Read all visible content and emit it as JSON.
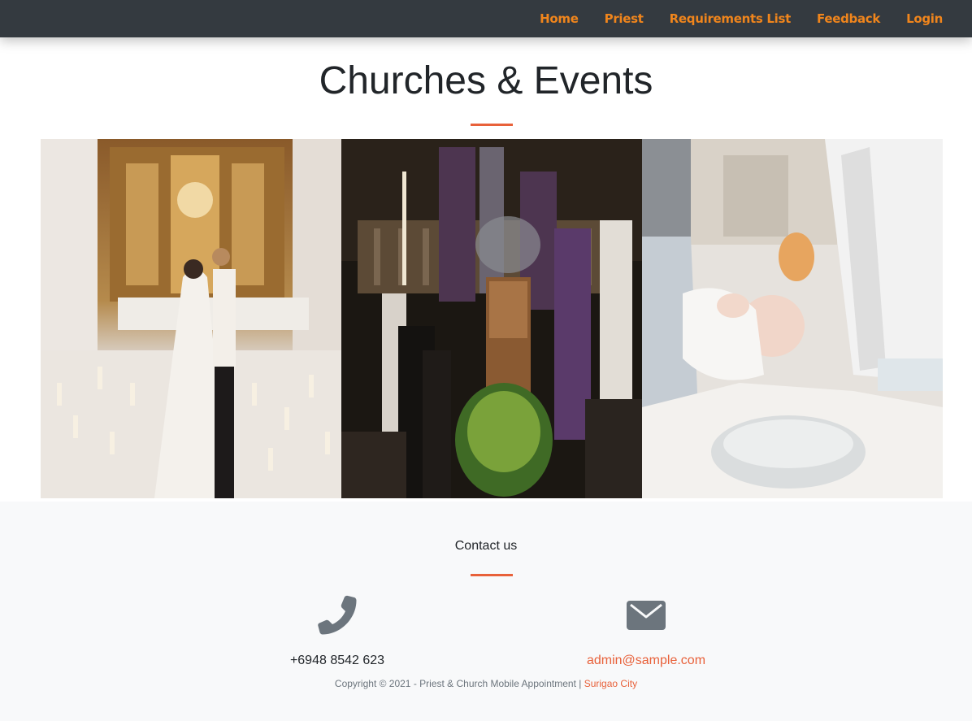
{
  "nav": {
    "items": [
      {
        "label": "Home"
      },
      {
        "label": "Priest"
      },
      {
        "label": "Requirements List"
      },
      {
        "label": "Feedback"
      },
      {
        "label": "Login"
      }
    ],
    "link_color": "#f0851c",
    "bar_color": "#343a40"
  },
  "main": {
    "title": "Churches & Events",
    "accent_color": "#e8613a",
    "gallery": [
      {
        "subject": "church-wedding-photo"
      },
      {
        "subject": "funeral-mass-photo"
      },
      {
        "subject": "infant-baptism-photo"
      }
    ]
  },
  "contact": {
    "title": "Contact us",
    "phone": {
      "icon": "phone-icon",
      "value": "+6948 8542 623"
    },
    "email": {
      "icon": "envelope-icon",
      "value": "admin@sample.com"
    },
    "copyright_text": "Copyright © 2021 - Priest & Church Mobile Appointment | ",
    "city": "Surigao City"
  }
}
